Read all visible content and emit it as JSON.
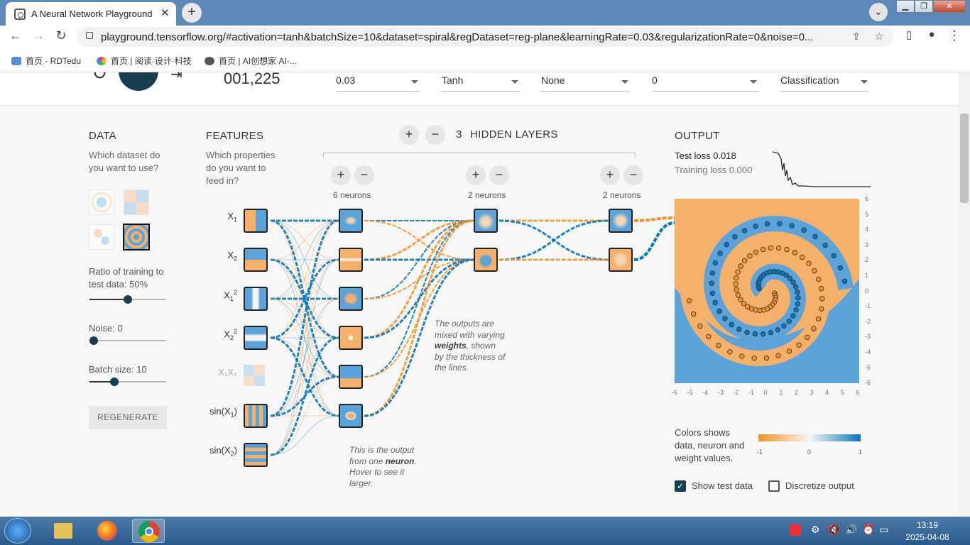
{
  "browser": {
    "tab_title": "A Neural Network Playground",
    "url": "playground.tensorflow.org/#activation=tanh&batchSize=10&dataset=spiral&regDataset=reg-plane&learningRate=0.03&regularizationRate=0&noise=0...",
    "bookmarks": [
      "首页 - RDTedu",
      "首页 | 阅读·设计·科技",
      "首页 | AI创想家 AI-..."
    ]
  },
  "controls": {
    "epoch": "001,225",
    "learning_rate": "0.03",
    "activation": "Tanh",
    "regularization": "None",
    "regularization_rate": "0",
    "problem_type": "Classification"
  },
  "data": {
    "heading": "DATA",
    "question": "Which dataset do you want to use?",
    "ratio_label": "Ratio of training to test data:",
    "ratio_value": "50%",
    "ratio_fraction": 0.5,
    "noise_label": "Noise:",
    "noise_value": "0",
    "noise_fraction": 0,
    "batch_label": "Batch size:",
    "batch_value": "10",
    "batch_fraction": 0.3,
    "regenerate": "REGENERATE"
  },
  "features": {
    "heading": "FEATURES",
    "question": "Which properties do you want to feed in?",
    "items": [
      {
        "base": "X",
        "sub": "1",
        "sup": "",
        "active": true
      },
      {
        "base": "X",
        "sub": "2",
        "sup": "",
        "active": true
      },
      {
        "base": "X",
        "sub": "1",
        "sup": "2",
        "active": true
      },
      {
        "base": "X",
        "sub": "2",
        "sup": "2",
        "active": true
      },
      {
        "base": "X₁X₂",
        "sub": "",
        "sup": "",
        "active": false
      },
      {
        "base": "sin(X",
        "sub": "1",
        "sup": ")",
        "active": true
      },
      {
        "base": "sin(X",
        "sub": "2",
        "sup": ")",
        "active": true
      }
    ]
  },
  "network": {
    "layers_count": "3",
    "layers_label": "HIDDEN LAYERS",
    "layers": [
      {
        "neurons_label": "6 neurons"
      },
      {
        "neurons_label": "2 neurons"
      },
      {
        "neurons_label": "2 neurons"
      }
    ],
    "annotation_weights": [
      "The outputs are mixed with varying ",
      "weights",
      ", shown by the thickness of the lines."
    ],
    "annotation_neuron": [
      "This is the output from one ",
      "neuron",
      ". Hover to see it larger."
    ]
  },
  "output": {
    "heading": "OUTPUT",
    "test_loss_label": "Test loss",
    "test_loss": "0.018",
    "training_loss_label": "Training loss",
    "training_loss": "0.000",
    "y_ticks": [
      "6",
      "5",
      "4",
      "3",
      "2",
      "1",
      "0",
      "-1",
      "-2",
      "-3",
      "-4",
      "-5",
      "-6"
    ],
    "x_ticks": [
      "-6",
      "-5",
      "-4",
      "-3",
      "-2",
      "-1",
      "0",
      "1",
      "2",
      "3",
      "4",
      "5",
      "6"
    ],
    "legend_text": "Colors shows data, neuron and weight values.",
    "legend_ticks": [
      "-1",
      "0",
      "1"
    ],
    "show_test": "Show test data",
    "show_test_checked": true,
    "discretize": "Discretize output",
    "discretize_checked": false
  },
  "taskbar": {
    "time": "13:19",
    "date": "2025-04-08"
  },
  "colors": {
    "orange": "#f59322",
    "blue": "#0877bd",
    "orange_bg": "#f5b06b",
    "blue_bg": "#5ba3d8",
    "dark": "#183d4e"
  }
}
